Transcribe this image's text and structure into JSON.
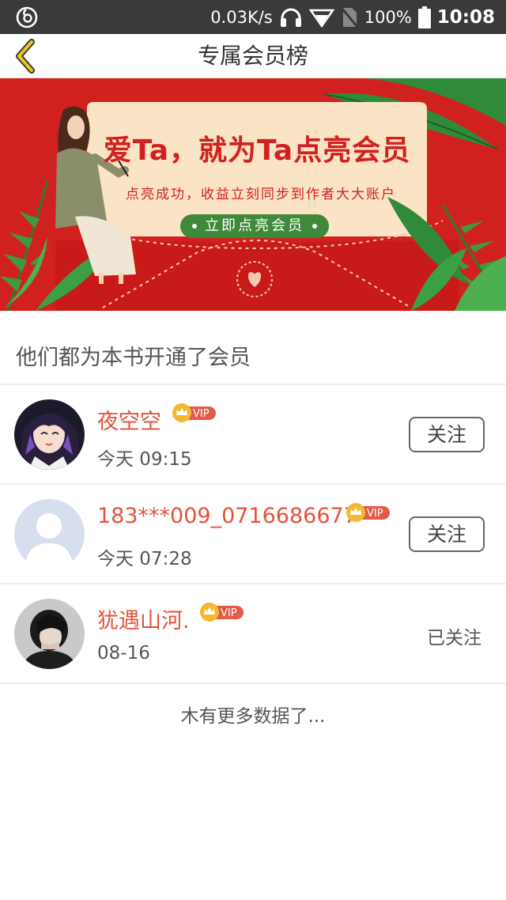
{
  "status_bar": {
    "speed": "0.03K/s",
    "battery": "100%",
    "time": "10:08",
    "icons": [
      "netease-cloud-icon",
      "headphones-icon",
      "wifi-icon",
      "no-sim-icon",
      "battery-icon"
    ]
  },
  "header": {
    "title": "专属会员榜",
    "back_icon": "chevron-left-icon"
  },
  "banner": {
    "headline": "爱Ta，就为Ta点亮会员",
    "subline": "点亮成功，收益立刻同步到作者大大账户",
    "button_label": "立即点亮会员"
  },
  "section": {
    "title": "他们都为本书开通了会员"
  },
  "members": [
    {
      "name": "夜空空",
      "badge": "VIP",
      "time": "今天 09:15",
      "action": "关注",
      "followed": false
    },
    {
      "name": "183***009_0716686677",
      "badge": "VIP",
      "time": "今天 07:28",
      "action": "关注",
      "followed": false
    },
    {
      "name": "犹遇山河.",
      "badge": "VIP",
      "time": "08-16",
      "action": "已关注",
      "followed": true
    }
  ],
  "footer": {
    "no_more": "木有更多数据了..."
  },
  "colors": {
    "status_bar": "#3a3a3a",
    "accent_name": "#e2533b",
    "banner_red": "#d1211f",
    "banner_green": "#3e8a3a",
    "back_icon": "#f0c419"
  }
}
